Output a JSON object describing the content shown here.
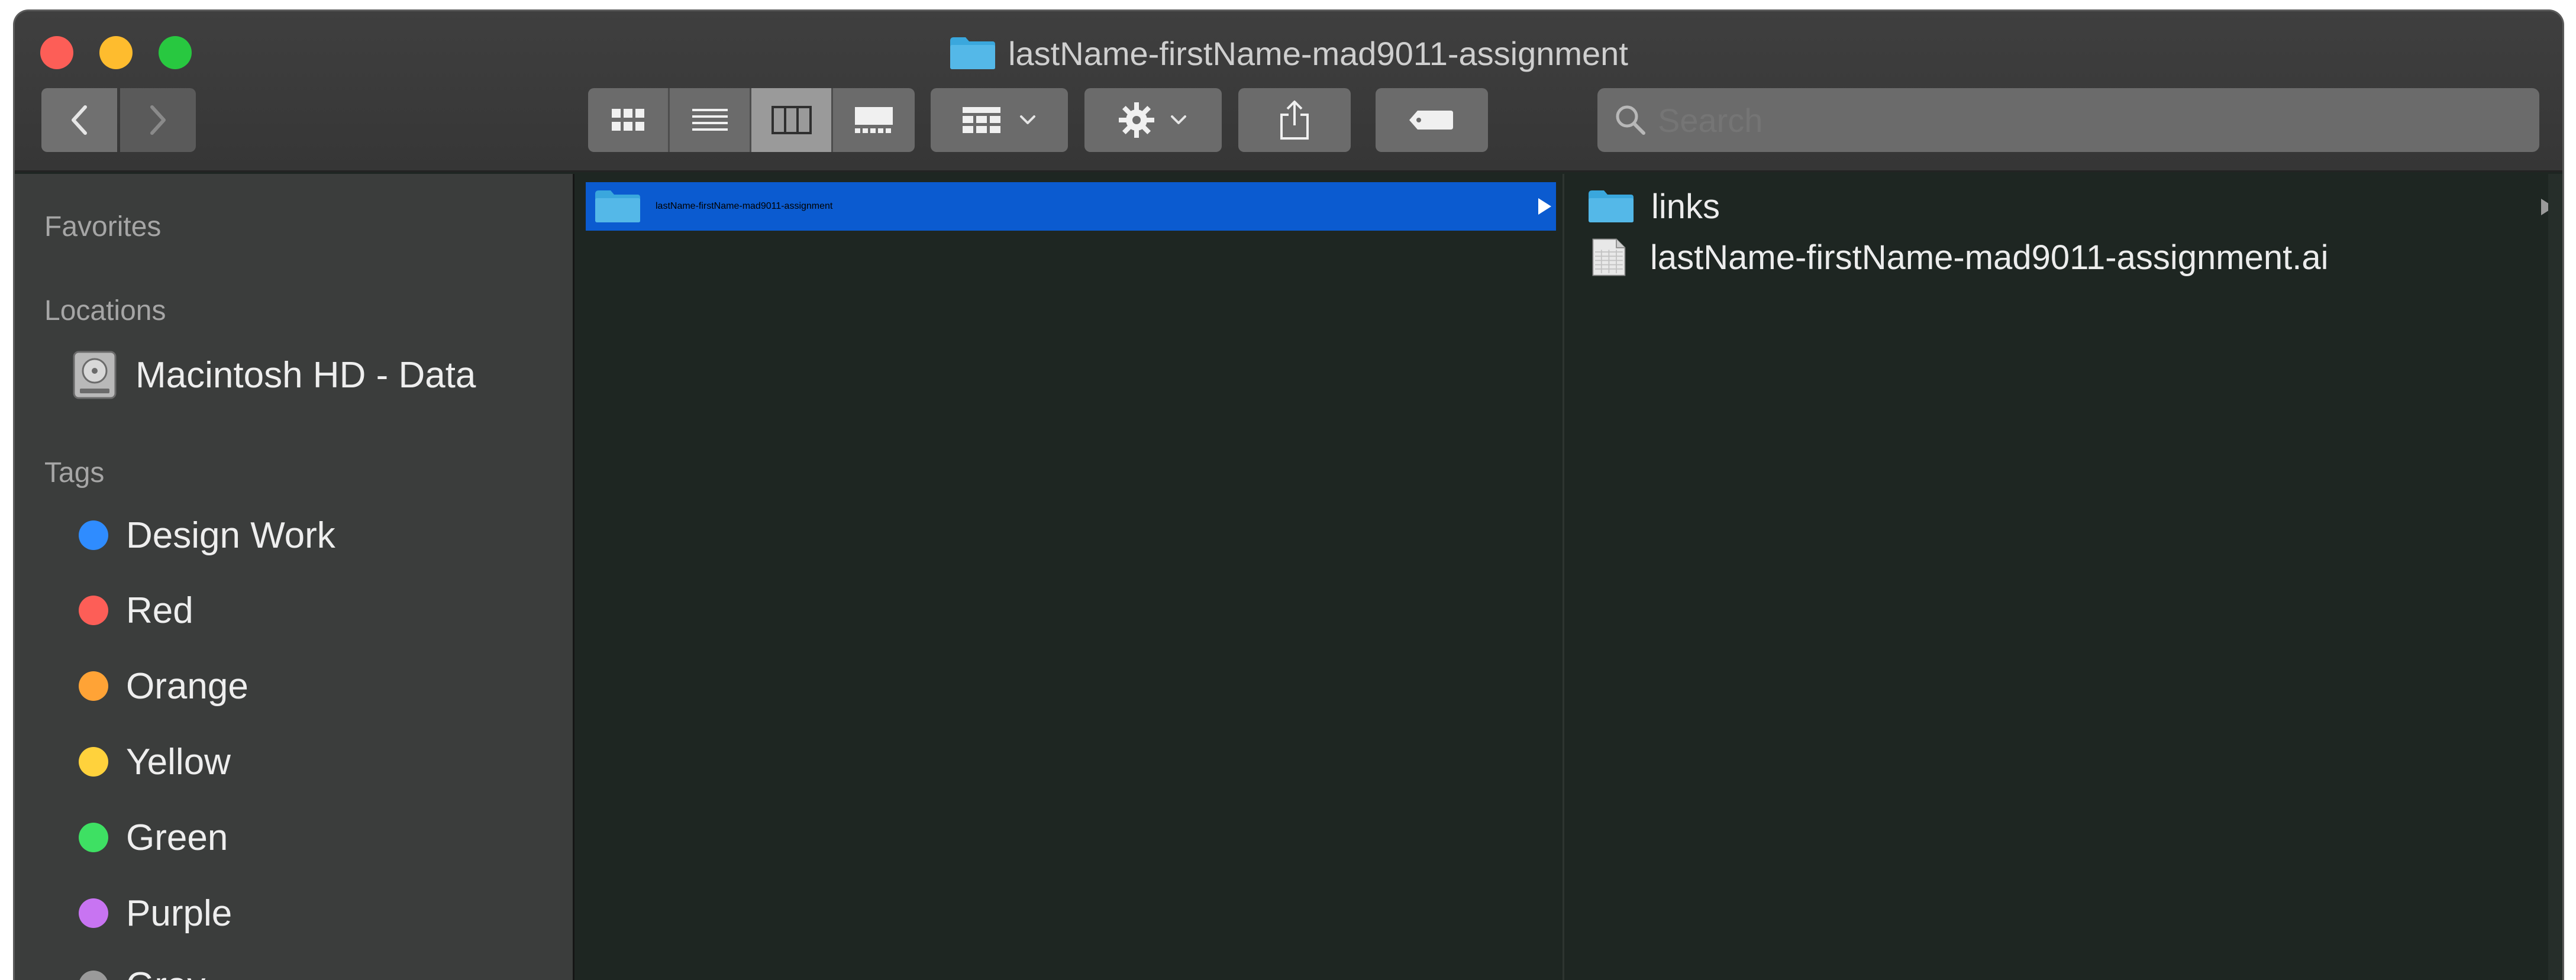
{
  "window": {
    "title": "lastName-firstName-mad9011-assignment"
  },
  "toolbar": {
    "back_icon": "chevron-left-icon",
    "forward_icon": "chevron-right-icon",
    "view_modes": [
      "icon-view-icon",
      "list-view-icon",
      "column-view-icon",
      "gallery-view-icon"
    ],
    "active_view": "column-view-icon",
    "group_icon": "group-by-icon",
    "action_icon": "gear-icon",
    "share_icon": "share-icon",
    "tag_icon": "tag-icon",
    "search_placeholder": "Search"
  },
  "sidebar": {
    "favorites_header": "Favorites",
    "locations_header": "Locations",
    "locations": [
      {
        "label": "Macintosh HD - Data",
        "icon": "hard-disk-icon"
      }
    ],
    "tags_header": "Tags",
    "tags": [
      {
        "label": "Design Work",
        "color": "#2f8cff"
      },
      {
        "label": "Red",
        "color": "#fd5e57"
      },
      {
        "label": "Orange",
        "color": "#ffa336"
      },
      {
        "label": "Yellow",
        "color": "#ffd23c"
      },
      {
        "label": "Green",
        "color": "#3ee063"
      },
      {
        "label": "Purple",
        "color": "#c874f2"
      },
      {
        "label": "Gray",
        "color": "#9a9a9a"
      }
    ]
  },
  "columns": {
    "col1": [
      {
        "name": "lastName-firstName-mad9011-assignment",
        "type": "folder",
        "selected": true
      }
    ],
    "col2": [
      {
        "name": "links",
        "type": "folder"
      },
      {
        "name": "lastName-firstName-mad9011-assignment.ai",
        "type": "file"
      }
    ]
  },
  "colors": {
    "selection": "#0b5bd0",
    "folder": "#3aa7dd",
    "sidebar_bg": "#3b3d3c",
    "content_bg": "#1e2622"
  }
}
